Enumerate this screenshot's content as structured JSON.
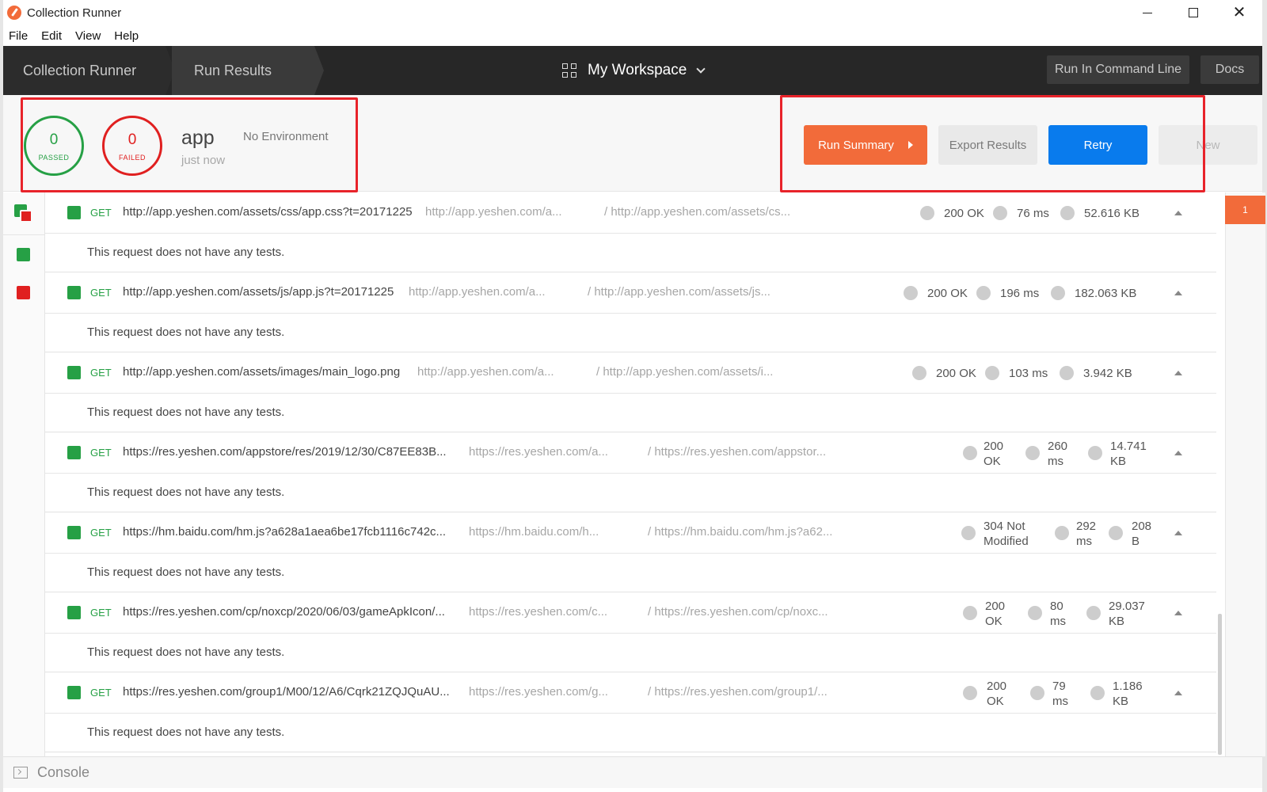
{
  "window": {
    "title": "Collection Runner"
  },
  "menu": [
    "File",
    "Edit",
    "View",
    "Help"
  ],
  "header": {
    "crumbs": [
      "Collection Runner",
      "Run Results"
    ],
    "workspace": "My Workspace",
    "run_cmd_label": "Run In Command Line",
    "docs_label": "Docs"
  },
  "summary": {
    "passed_count": "0",
    "passed_label": "PASSED",
    "failed_count": "0",
    "failed_label": "FAILED",
    "collection_name": "app",
    "time": "just now",
    "environment": "No Environment",
    "run_summary_label": "Run Summary",
    "export_label": "Export Results",
    "retry_label": "Retry",
    "new_label": "New"
  },
  "iteration_badge": "1",
  "no_tests_text": "This request does not have any tests.",
  "requests": [
    {
      "method": "GET",
      "url": "http://app.yeshen.com/assets/css/app.css?t=20171225",
      "url2": "http://app.yeshen.com/a...",
      "url3": "/ http://app.yeshen.com/assets/cs...",
      "status": "200 OK",
      "time": "76 ms",
      "size": "52.616 KB"
    },
    {
      "method": "GET",
      "url": "http://app.yeshen.com/assets/js/app.js?t=20171225",
      "url2": "http://app.yeshen.com/a...",
      "url3": "/ http://app.yeshen.com/assets/js...",
      "status": "200 OK",
      "time": "196 ms",
      "size": "182.063 KB"
    },
    {
      "method": "GET",
      "url": "http://app.yeshen.com/assets/images/main_logo.png",
      "url2": "http://app.yeshen.com/a...",
      "url3": "/ http://app.yeshen.com/assets/i...",
      "status": "200 OK",
      "time": "103 ms",
      "size": "3.942 KB"
    },
    {
      "method": "GET",
      "url": "https://res.yeshen.com/appstore/res/2019/12/30/C87EE83B...",
      "url2": "https://res.yeshen.com/a...",
      "url3": "/ https://res.yeshen.com/appstor...",
      "status": "200 OK",
      "time": "260 ms",
      "size": "14.741 KB"
    },
    {
      "method": "GET",
      "url": "https://hm.baidu.com/hm.js?a628a1aea6be17fcb1116c742c...",
      "url2": "https://hm.baidu.com/h...",
      "url3": "/ https://hm.baidu.com/hm.js?a62...",
      "status": "304 Not Modified",
      "time": "292 ms",
      "size": "208 B"
    },
    {
      "method": "GET",
      "url": "https://res.yeshen.com/cp/noxcp/2020/06/03/gameApkIcon/...",
      "url2": "https://res.yeshen.com/c...",
      "url3": "/ https://res.yeshen.com/cp/noxc...",
      "status": "200 OK",
      "time": "80 ms",
      "size": "29.037 KB"
    },
    {
      "method": "GET",
      "url": "https://res.yeshen.com/group1/M00/12/A6/Cqrk21ZQJQuAU...",
      "url2": "https://res.yeshen.com/g...",
      "url3": "/ https://res.yeshen.com/group1/...",
      "status": "200 OK",
      "time": "79 ms",
      "size": "1.186 KB"
    }
  ],
  "console": {
    "label": "Console"
  },
  "colors": {
    "accent": "#f26b3a",
    "primary": "#097bed",
    "pass": "#26a045",
    "fail": "#e02020",
    "header_bg": "#272727"
  }
}
